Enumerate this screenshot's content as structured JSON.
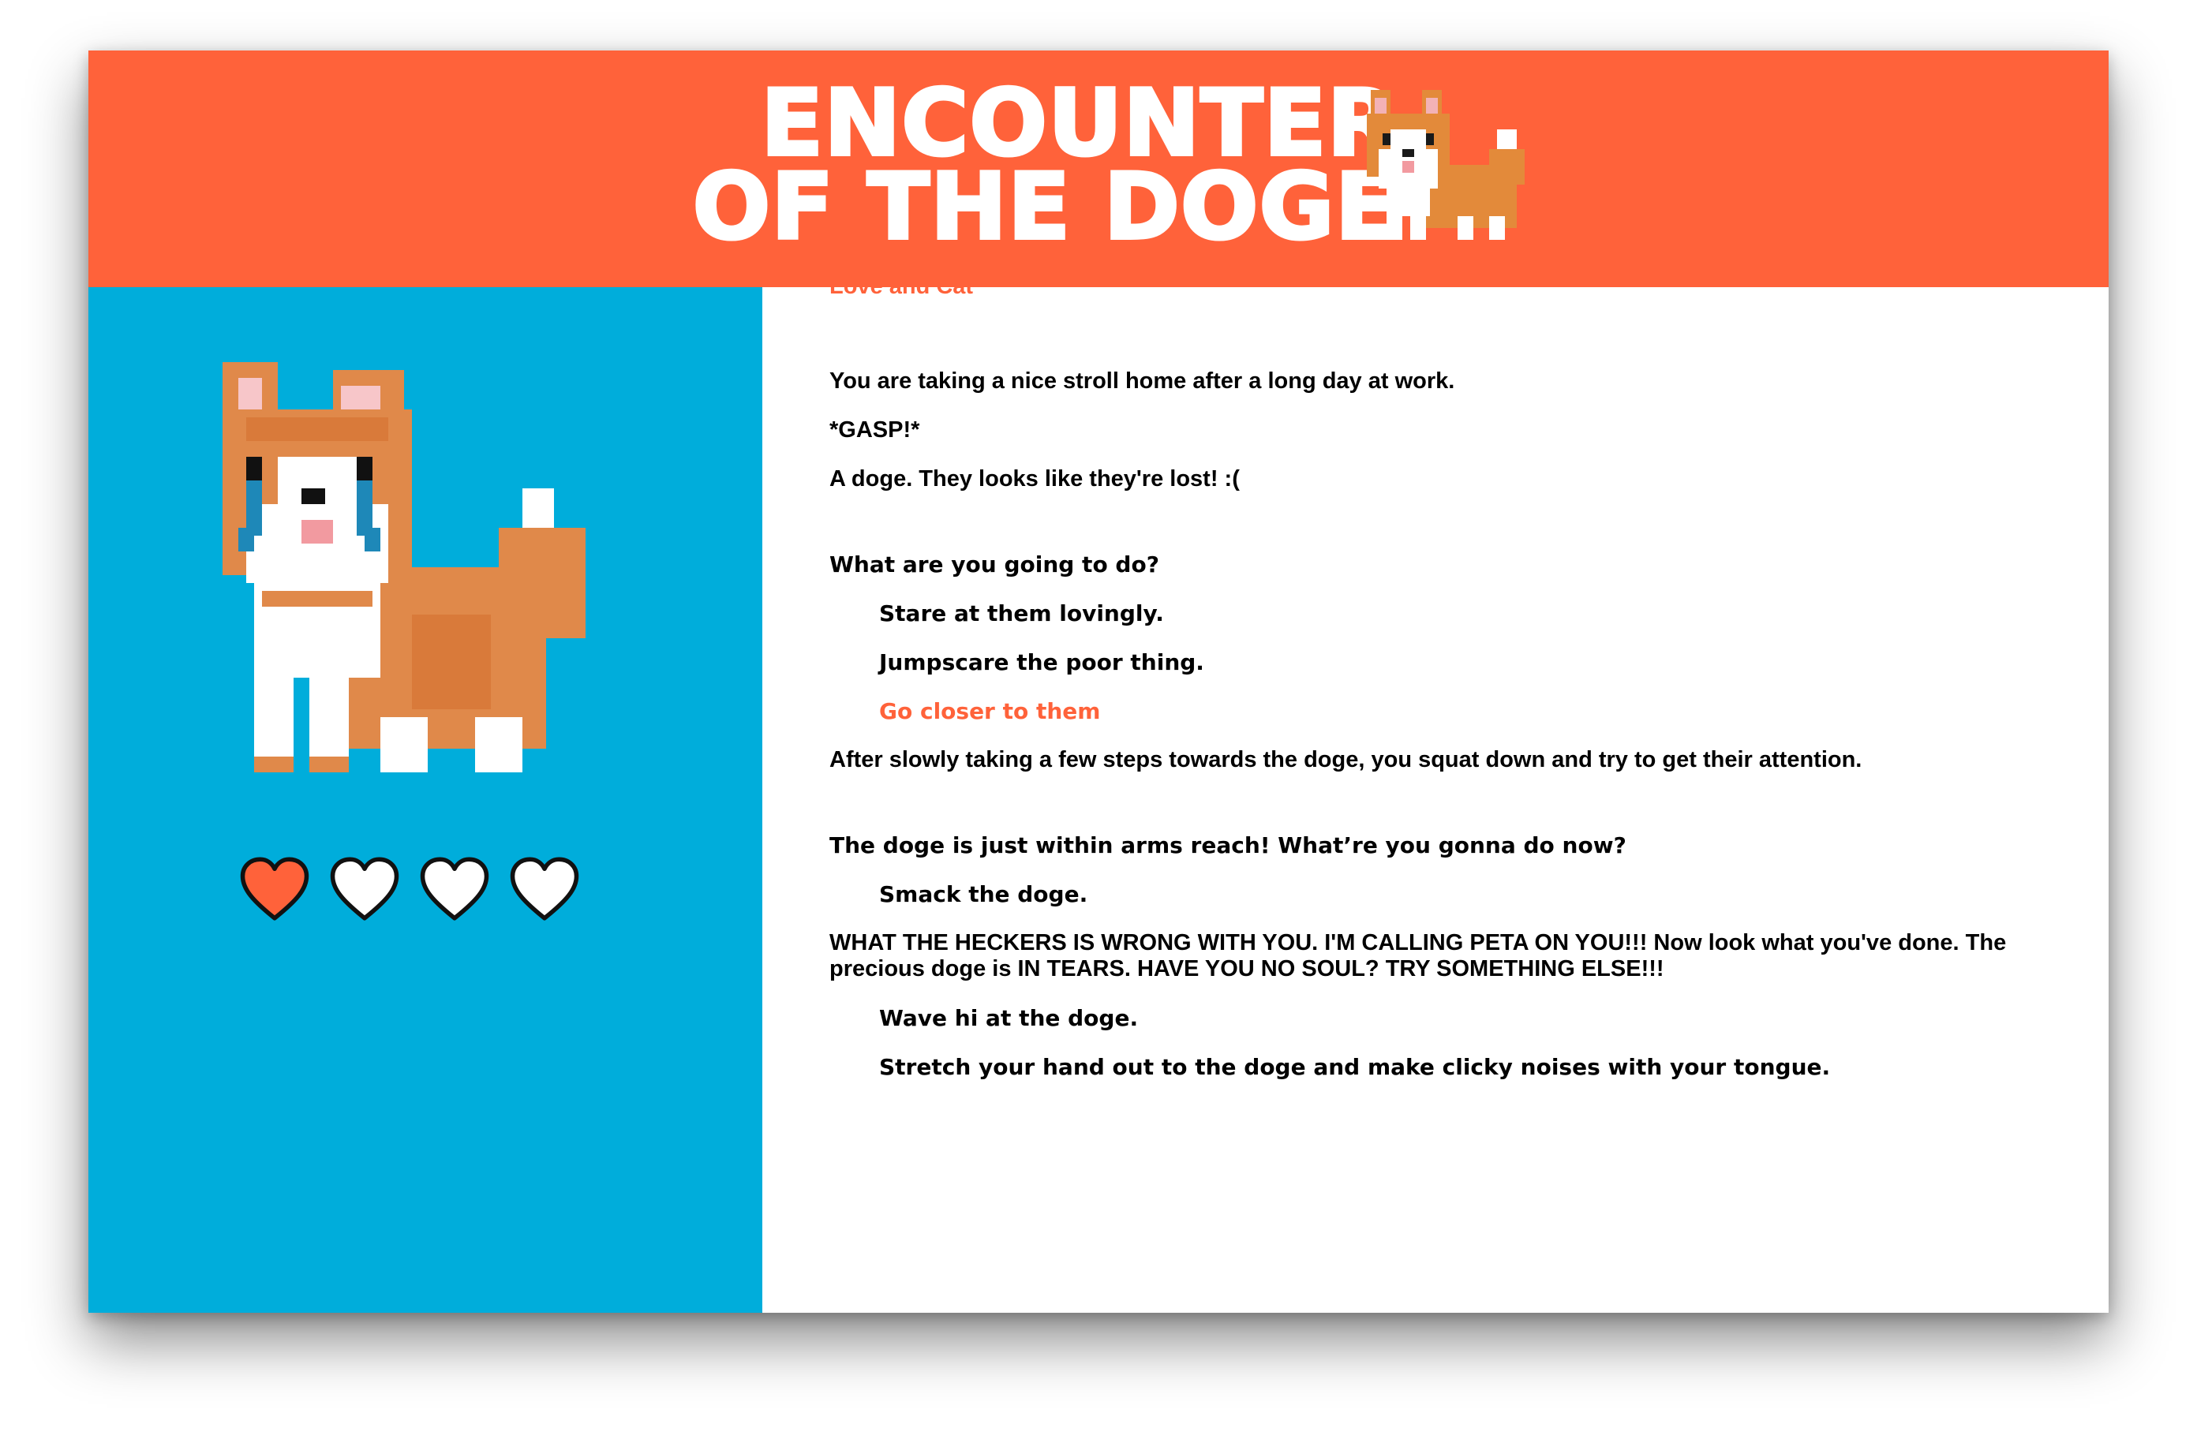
{
  "header": {
    "title_line1": "ENCOUNTER",
    "title_line2": "OF THE DOGE",
    "logo_icon": "corgi-icon"
  },
  "sidebar": {
    "dog_icon": "crying-corgi-icon",
    "hearts": [
      {
        "state": "filled",
        "color": "#ff623a"
      },
      {
        "state": "empty",
        "color": "#ffffff"
      },
      {
        "state": "empty",
        "color": "#ffffff"
      },
      {
        "state": "empty",
        "color": "#ffffff"
      }
    ]
  },
  "story": {
    "clipped_top": "Love and Cat",
    "intro": [
      "You are taking a nice stroll home after a long day at work.",
      "*GASP!*",
      "A doge. They looks like they're lost! :("
    ],
    "prompt1": "What are you going to do?",
    "choices1": [
      "Stare at them lovingly.",
      "Jumpscare the poor thing.",
      "Go closer to them"
    ],
    "result1": "After slowly taking a few steps towards the doge, you squat down and try to get their attention.",
    "prompt2": "The doge is just within arms reach! What’re you gonna do now?",
    "choice2a": "Smack the doge.",
    "response2a": "WHAT THE HECKERS IS WRONG WITH YOU. I'M CALLING PETA ON YOU!!! Now look what you've done. The precious doge is IN TEARS. HAVE YOU NO SOUL? TRY SOMETHING ELSE!!!",
    "choices2": [
      "Wave hi at the doge.",
      "Stretch your hand out to the doge and make clicky noises with your tongue."
    ]
  },
  "colors": {
    "header": "#ff623a",
    "sidebar": "#00addb",
    "accent": "#ff623a",
    "text": "#000000"
  }
}
